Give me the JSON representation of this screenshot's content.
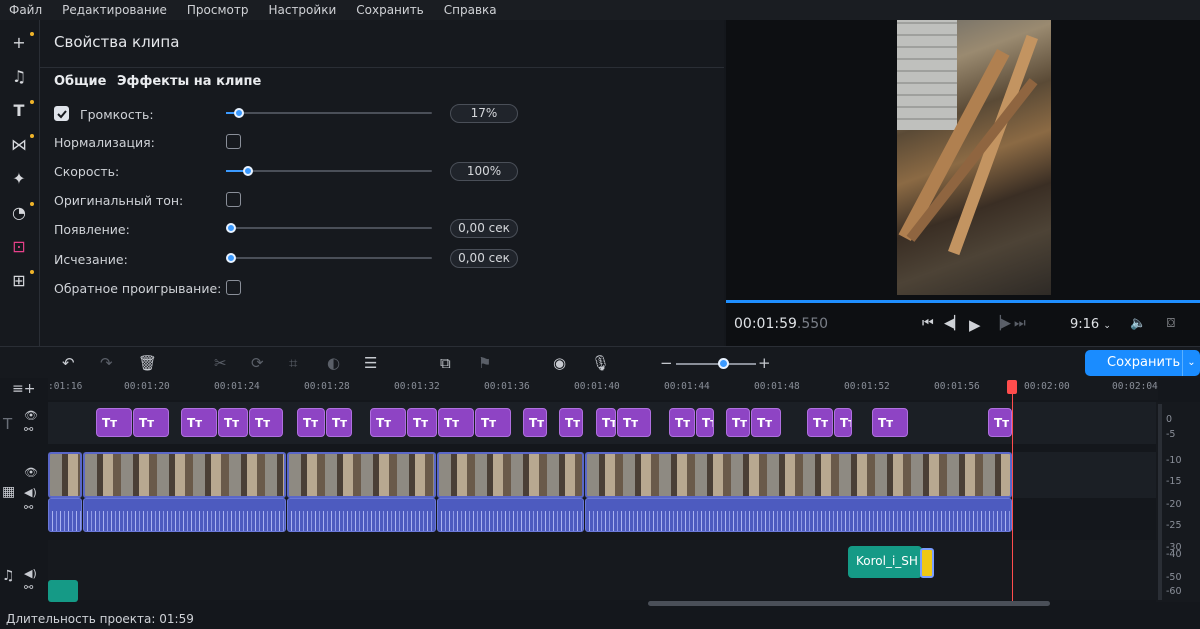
{
  "menu": [
    "Файл",
    "Редактирование",
    "Просмотр",
    "Настройки",
    "Сохранить",
    "Справка"
  ],
  "sidebar": {
    "icons": [
      "add-icon",
      "music-note-icon",
      "text-icon",
      "transitions-icon",
      "magic-wand-icon",
      "sticker-icon",
      "clip-properties-icon",
      "more-tools-icon"
    ]
  },
  "panel": {
    "title": "Свойства клипа",
    "tabs": [
      "Общие",
      "Эффекты на клипе"
    ],
    "rows": {
      "volume": {
        "label": "Громкость:",
        "checked": true,
        "value": "17%",
        "level": 0.05
      },
      "normalize": {
        "label": "Нормализация:",
        "checked": false
      },
      "speed": {
        "label": "Скорость:",
        "value": "100%",
        "level": 0.1
      },
      "original_tone": {
        "label": "Оригинальный тон:",
        "checked": false
      },
      "fade_in": {
        "label": "Появление:",
        "value": "0,00 сек",
        "level": 0
      },
      "fade_out": {
        "label": "Исчезание:",
        "value": "0,00 сек",
        "level": 0
      },
      "reverse": {
        "label": "Обратное проигрывание:",
        "checked": false
      }
    }
  },
  "player": {
    "time_main": "00:01:59",
    "time_ms": ".550",
    "aspect": "9:16",
    "progress": 1.0
  },
  "toolbar": {
    "save_label": "Сохранить",
    "zoom_level": 0.55
  },
  "ruler": {
    "labels": [
      ":01:16",
      "00:01:20",
      "00:01:24",
      "00:01:28",
      "00:01:32",
      "00:01:36",
      "00:01:40",
      "00:01:44",
      "00:01:48",
      "00:01:52",
      "00:01:56",
      "00:02:00",
      "00:02:04"
    ]
  },
  "timeline": {
    "title_clip_label": "Tт",
    "music_clip_label": "Korol_i_SH"
  },
  "vu": {
    "labels": [
      "0",
      "-5",
      "-10",
      "-15",
      "-20",
      "-25",
      "-30",
      "-40",
      "-50",
      "-60"
    ]
  },
  "status": {
    "duration": "Длительность проекта: 01:59"
  },
  "colors": {
    "accent": "#1a8cff",
    "title_clip": "#8e44c4",
    "video_border": "#5a67c8",
    "audio": "#4d5bbf",
    "music": "#159a86",
    "playhead": "#ff4d4d"
  }
}
